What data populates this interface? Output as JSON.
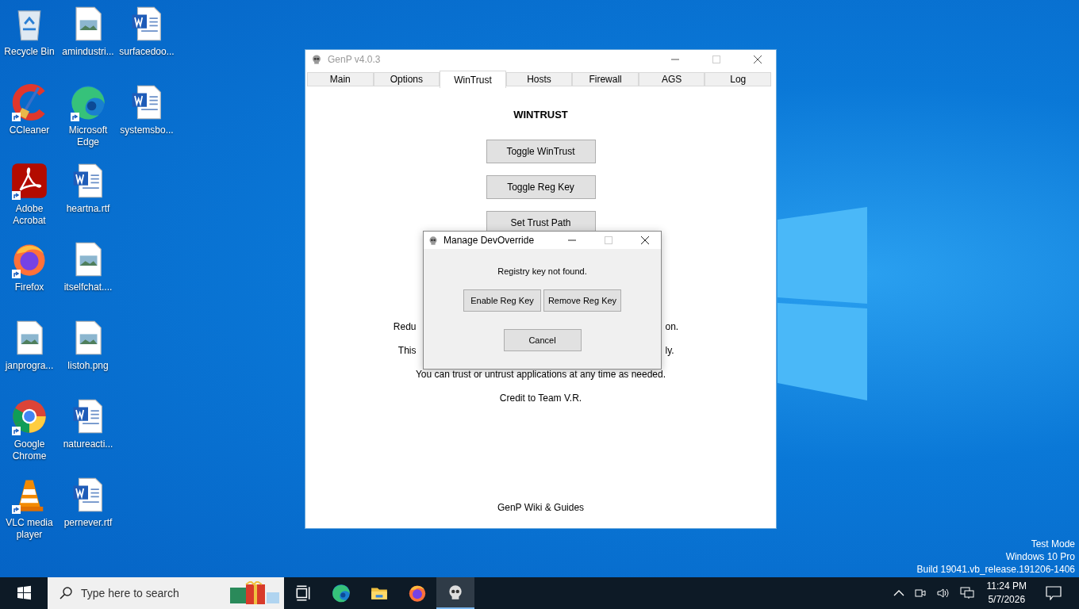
{
  "desktop_icons": [
    {
      "label": "Recycle Bin",
      "kind": "recycle",
      "shortcut": false
    },
    {
      "label": "CCleaner",
      "kind": "ccleaner",
      "shortcut": true
    },
    {
      "label": "Adobe Acrobat",
      "kind": "acrobat",
      "shortcut": true
    },
    {
      "label": "Firefox",
      "kind": "firefox",
      "shortcut": true
    },
    {
      "label": "janprogra...",
      "kind": "image",
      "shortcut": false
    },
    {
      "label": "Google Chrome",
      "kind": "chrome",
      "shortcut": true
    },
    {
      "label": "VLC media player",
      "kind": "vlc",
      "shortcut": true
    },
    {
      "label": "amindustri...",
      "kind": "image",
      "shortcut": false
    },
    {
      "label": "Microsoft Edge",
      "kind": "edge",
      "shortcut": true
    },
    {
      "label": "heartna.rtf",
      "kind": "word",
      "shortcut": false
    },
    {
      "label": "itselfchat....",
      "kind": "image",
      "shortcut": false
    },
    {
      "label": "listoh.png",
      "kind": "image",
      "shortcut": false
    },
    {
      "label": "natureacti...",
      "kind": "word",
      "shortcut": false
    },
    {
      "label": "pernever.rtf",
      "kind": "word",
      "shortcut": false
    },
    {
      "label": "surfacedoo...",
      "kind": "word",
      "shortcut": false
    },
    {
      "label": "systemsbo...",
      "kind": "word",
      "shortcut": false
    }
  ],
  "main_window": {
    "title": "GenP v4.0.3",
    "tabs": [
      {
        "label": "Main",
        "selected": false
      },
      {
        "label": "Options",
        "selected": false
      },
      {
        "label": "WinTrust",
        "selected": true
      },
      {
        "label": "Hosts",
        "selected": false
      },
      {
        "label": "Firewall",
        "selected": false
      },
      {
        "label": "AGS",
        "selected": false
      },
      {
        "label": "Log",
        "selected": false
      }
    ],
    "heading": "WINTRUST",
    "buttons": [
      "Toggle WinTrust",
      "Toggle Reg Key",
      "Set Trust Path"
    ],
    "lines": [
      {
        "kind": "split",
        "start": "Redu",
        "end": "on."
      },
      {
        "kind": "split",
        "start": "This",
        "end": "ly."
      },
      {
        "kind": "full",
        "text": "You can trust or untrust applications at any time as needed."
      },
      {
        "kind": "full",
        "text": "Credit to Team V.R."
      }
    ],
    "footer_link": "GenP Wiki & Guides"
  },
  "dialog": {
    "title": "Manage DevOverride",
    "message": "Registry key not found.",
    "buttons": [
      "Enable Reg Key",
      "Remove Reg Key"
    ],
    "cancel": "Cancel"
  },
  "watermark": [
    "Test Mode",
    "Windows 10 Pro",
    "Build 19041.vb_release.191206-1406"
  ],
  "taskbar": {
    "search_placeholder": "Type here to search",
    "apps": [
      {
        "kind": "taskview",
        "active": false
      },
      {
        "kind": "edge",
        "active": false
      },
      {
        "kind": "explorer",
        "active": false
      },
      {
        "kind": "firefox",
        "active": false
      },
      {
        "kind": "skull",
        "active": true
      }
    ],
    "time": "11:24 PM",
    "date": "5/7/2026"
  }
}
